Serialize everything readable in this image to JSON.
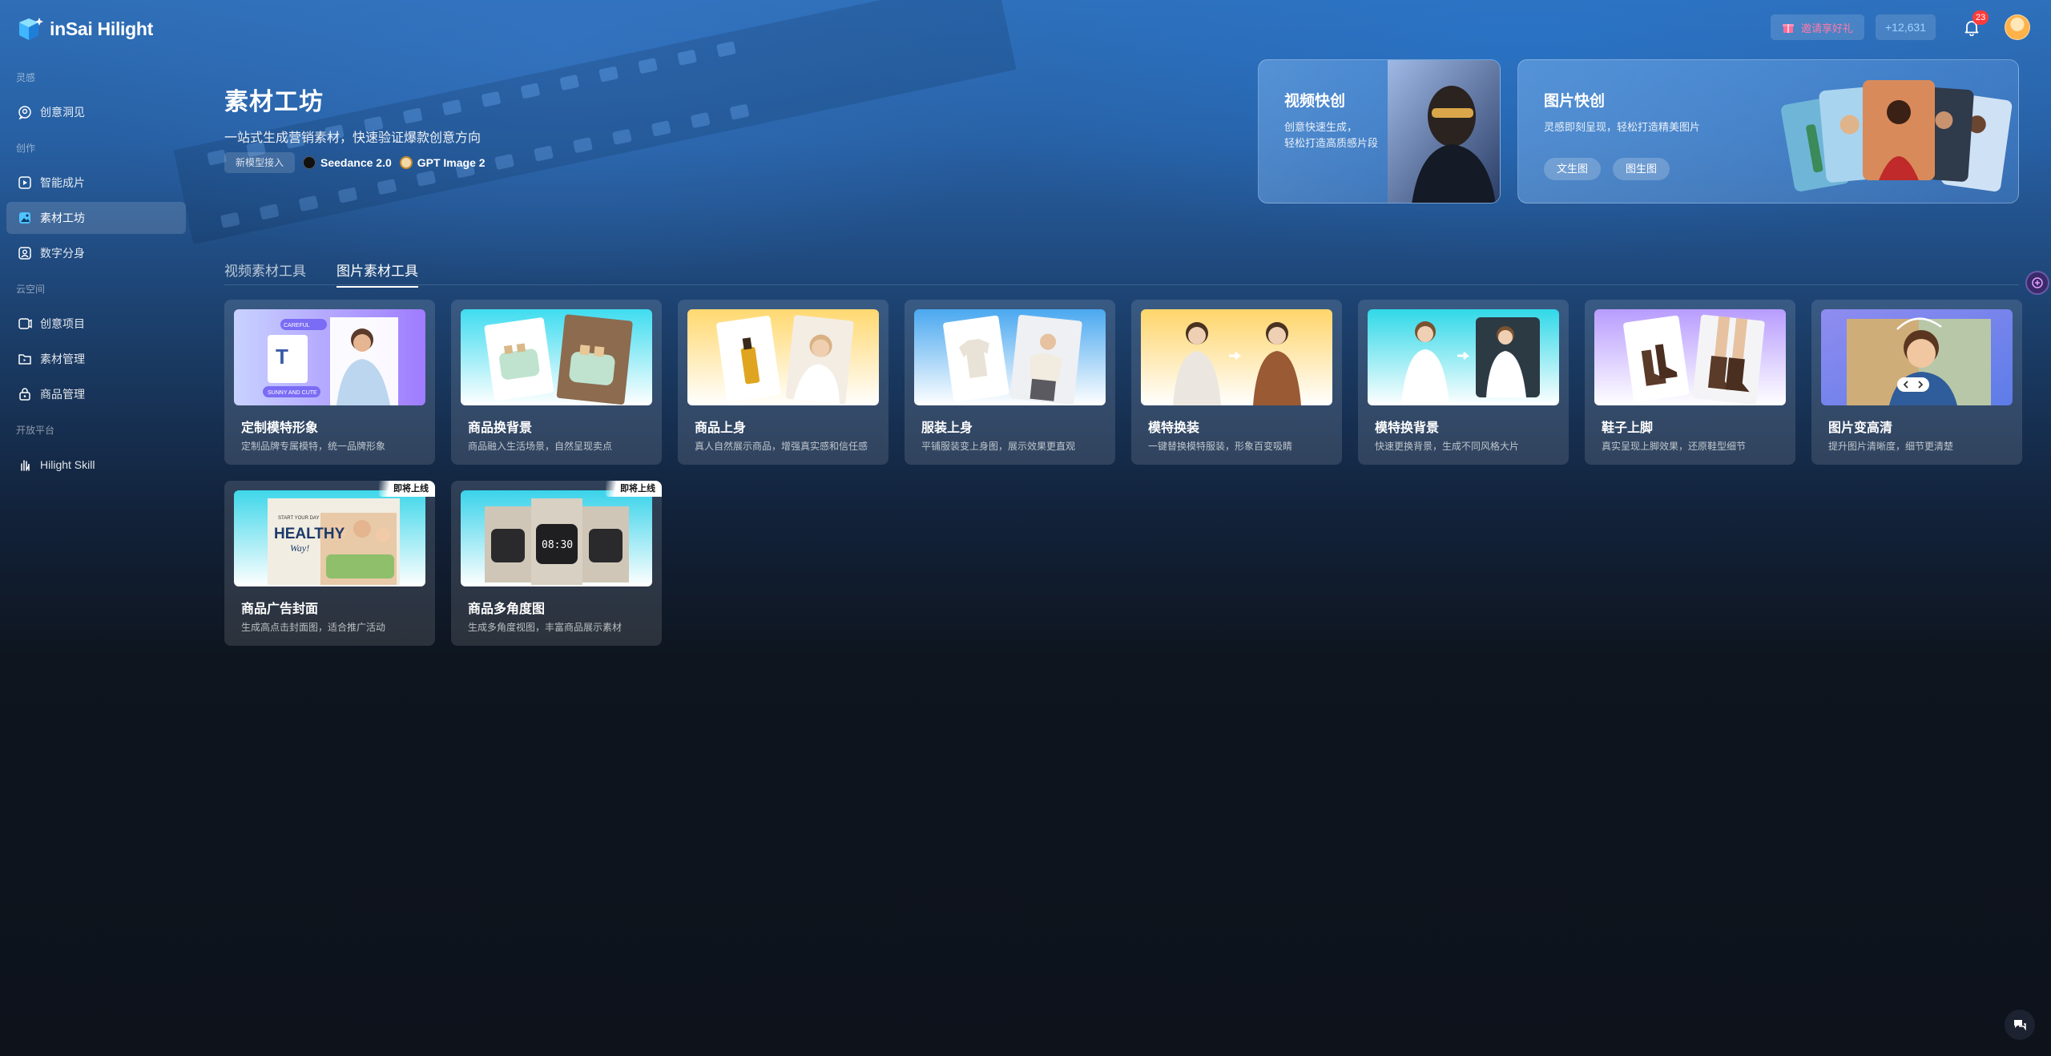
{
  "app": {
    "name": "inSai Hilight"
  },
  "sidebar": {
    "groups": [
      {
        "label": "灵感",
        "items": [
          {
            "label": "创意洞见",
            "icon": "lightbulb-chat-icon"
          }
        ]
      },
      {
        "label": "创作",
        "items": [
          {
            "label": "智能成片",
            "icon": "video-play-icon"
          },
          {
            "label": "素材工坊",
            "icon": "image-gallery-icon",
            "active": true
          },
          {
            "label": "数字分身",
            "icon": "person-card-icon"
          }
        ]
      },
      {
        "label": "云空间",
        "items": [
          {
            "label": "创意项目",
            "icon": "project-icon"
          },
          {
            "label": "素材管理",
            "icon": "folder-icon"
          },
          {
            "label": "商品管理",
            "icon": "product-lock-icon"
          }
        ]
      },
      {
        "label": "开放平台",
        "items": [
          {
            "label": "Hilight Skill",
            "icon": "skill-hand-icon"
          }
        ]
      }
    ]
  },
  "topbar": {
    "gift_label": "邀请享好礼",
    "credits": "+12,631",
    "notification_count": "23"
  },
  "hero": {
    "title": "素材工坊",
    "subtitle": "一站式生成营销素材，快速验证爆款创意方向",
    "model_tag": "新模型接入",
    "models": [
      "Seedance 2.0",
      "GPT Image 2"
    ]
  },
  "promos": {
    "video": {
      "title": "视频快创",
      "desc_line1": "创意快速生成，",
      "desc_line2": "轻松打造高质感片段"
    },
    "image": {
      "title": "图片快创",
      "desc": "灵感即刻呈现，轻松打造精美图片",
      "buttons": [
        "文生图",
        "图生图"
      ]
    }
  },
  "tabs": [
    {
      "label": "视频素材工具",
      "active": false
    },
    {
      "label": "图片素材工具",
      "active": true
    }
  ],
  "tools": [
    {
      "title": "定制模特形象",
      "desc": "定制品牌专属模特，统一品牌形象"
    },
    {
      "title": "商品换背景",
      "desc": "商品融入生活场景，自然呈现卖点"
    },
    {
      "title": "商品上身",
      "desc": "真人自然展示商品，增强真实感和信任感"
    },
    {
      "title": "服装上身",
      "desc": "平铺服装变上身图，展示效果更直观"
    },
    {
      "title": "模特换装",
      "desc": "一键替换模特服装，形象百变吸睛"
    },
    {
      "title": "模特换背景",
      "desc": "快速更换背景，生成不同风格大片"
    },
    {
      "title": "鞋子上脚",
      "desc": "真实呈现上脚效果，还原鞋型细节"
    },
    {
      "title": "图片变高清",
      "desc": "提升图片清晰度，细节更清楚"
    },
    {
      "title": "商品广告封面",
      "desc": "生成高点击封面图，适合推广活动",
      "ribbon": "即将上线"
    },
    {
      "title": "商品多角度图",
      "desc": "生成多角度视图，丰富商品展示素材",
      "ribbon": "即将上线"
    }
  ],
  "thumb_text": {
    "model_chips": [
      "CAREFUL",
      "SUNNY AND CUTE"
    ],
    "ad_cover_lines": [
      "START YOUR DAY",
      "HEALTHY",
      "Way!"
    ],
    "clock_time": "08:30"
  }
}
